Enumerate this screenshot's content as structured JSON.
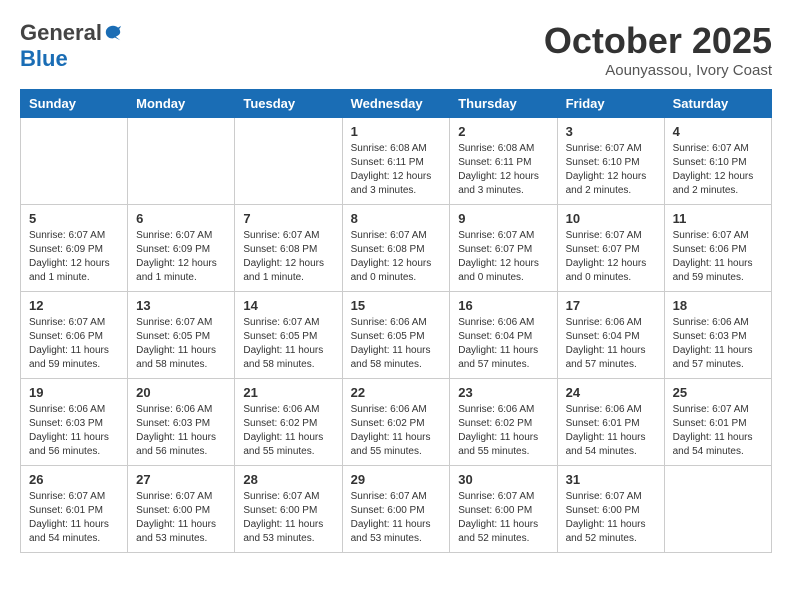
{
  "logo": {
    "general": "General",
    "blue": "Blue"
  },
  "title": "October 2025",
  "location": "Aounyassou, Ivory Coast",
  "days_of_week": [
    "Sunday",
    "Monday",
    "Tuesday",
    "Wednesday",
    "Thursday",
    "Friday",
    "Saturday"
  ],
  "weeks": [
    [
      {
        "day": "",
        "info": ""
      },
      {
        "day": "",
        "info": ""
      },
      {
        "day": "",
        "info": ""
      },
      {
        "day": "1",
        "info": "Sunrise: 6:08 AM\nSunset: 6:11 PM\nDaylight: 12 hours and 3 minutes."
      },
      {
        "day": "2",
        "info": "Sunrise: 6:08 AM\nSunset: 6:11 PM\nDaylight: 12 hours and 3 minutes."
      },
      {
        "day": "3",
        "info": "Sunrise: 6:07 AM\nSunset: 6:10 PM\nDaylight: 12 hours and 2 minutes."
      },
      {
        "day": "4",
        "info": "Sunrise: 6:07 AM\nSunset: 6:10 PM\nDaylight: 12 hours and 2 minutes."
      }
    ],
    [
      {
        "day": "5",
        "info": "Sunrise: 6:07 AM\nSunset: 6:09 PM\nDaylight: 12 hours and 1 minute."
      },
      {
        "day": "6",
        "info": "Sunrise: 6:07 AM\nSunset: 6:09 PM\nDaylight: 12 hours and 1 minute."
      },
      {
        "day": "7",
        "info": "Sunrise: 6:07 AM\nSunset: 6:08 PM\nDaylight: 12 hours and 1 minute."
      },
      {
        "day": "8",
        "info": "Sunrise: 6:07 AM\nSunset: 6:08 PM\nDaylight: 12 hours and 0 minutes."
      },
      {
        "day": "9",
        "info": "Sunrise: 6:07 AM\nSunset: 6:07 PM\nDaylight: 12 hours and 0 minutes."
      },
      {
        "day": "10",
        "info": "Sunrise: 6:07 AM\nSunset: 6:07 PM\nDaylight: 12 hours and 0 minutes."
      },
      {
        "day": "11",
        "info": "Sunrise: 6:07 AM\nSunset: 6:06 PM\nDaylight: 11 hours and 59 minutes."
      }
    ],
    [
      {
        "day": "12",
        "info": "Sunrise: 6:07 AM\nSunset: 6:06 PM\nDaylight: 11 hours and 59 minutes."
      },
      {
        "day": "13",
        "info": "Sunrise: 6:07 AM\nSunset: 6:05 PM\nDaylight: 11 hours and 58 minutes."
      },
      {
        "day": "14",
        "info": "Sunrise: 6:07 AM\nSunset: 6:05 PM\nDaylight: 11 hours and 58 minutes."
      },
      {
        "day": "15",
        "info": "Sunrise: 6:06 AM\nSunset: 6:05 PM\nDaylight: 11 hours and 58 minutes."
      },
      {
        "day": "16",
        "info": "Sunrise: 6:06 AM\nSunset: 6:04 PM\nDaylight: 11 hours and 57 minutes."
      },
      {
        "day": "17",
        "info": "Sunrise: 6:06 AM\nSunset: 6:04 PM\nDaylight: 11 hours and 57 minutes."
      },
      {
        "day": "18",
        "info": "Sunrise: 6:06 AM\nSunset: 6:03 PM\nDaylight: 11 hours and 57 minutes."
      }
    ],
    [
      {
        "day": "19",
        "info": "Sunrise: 6:06 AM\nSunset: 6:03 PM\nDaylight: 11 hours and 56 minutes."
      },
      {
        "day": "20",
        "info": "Sunrise: 6:06 AM\nSunset: 6:03 PM\nDaylight: 11 hours and 56 minutes."
      },
      {
        "day": "21",
        "info": "Sunrise: 6:06 AM\nSunset: 6:02 PM\nDaylight: 11 hours and 55 minutes."
      },
      {
        "day": "22",
        "info": "Sunrise: 6:06 AM\nSunset: 6:02 PM\nDaylight: 11 hours and 55 minutes."
      },
      {
        "day": "23",
        "info": "Sunrise: 6:06 AM\nSunset: 6:02 PM\nDaylight: 11 hours and 55 minutes."
      },
      {
        "day": "24",
        "info": "Sunrise: 6:06 AM\nSunset: 6:01 PM\nDaylight: 11 hours and 54 minutes."
      },
      {
        "day": "25",
        "info": "Sunrise: 6:07 AM\nSunset: 6:01 PM\nDaylight: 11 hours and 54 minutes."
      }
    ],
    [
      {
        "day": "26",
        "info": "Sunrise: 6:07 AM\nSunset: 6:01 PM\nDaylight: 11 hours and 54 minutes."
      },
      {
        "day": "27",
        "info": "Sunrise: 6:07 AM\nSunset: 6:00 PM\nDaylight: 11 hours and 53 minutes."
      },
      {
        "day": "28",
        "info": "Sunrise: 6:07 AM\nSunset: 6:00 PM\nDaylight: 11 hours and 53 minutes."
      },
      {
        "day": "29",
        "info": "Sunrise: 6:07 AM\nSunset: 6:00 PM\nDaylight: 11 hours and 53 minutes."
      },
      {
        "day": "30",
        "info": "Sunrise: 6:07 AM\nSunset: 6:00 PM\nDaylight: 11 hours and 52 minutes."
      },
      {
        "day": "31",
        "info": "Sunrise: 6:07 AM\nSunset: 6:00 PM\nDaylight: 11 hours and 52 minutes."
      },
      {
        "day": "",
        "info": ""
      }
    ]
  ]
}
